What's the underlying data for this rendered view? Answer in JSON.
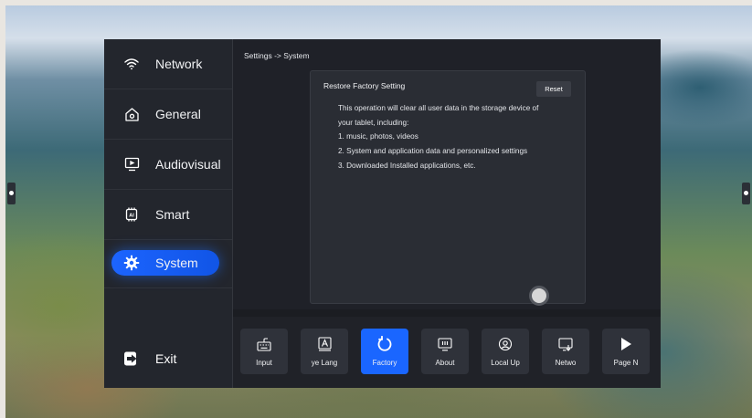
{
  "sidebar": {
    "items": [
      {
        "label": "Network",
        "icon": "wifi-icon"
      },
      {
        "label": "General",
        "icon": "home-settings-icon"
      },
      {
        "label": "Audiovisual",
        "icon": "monitor-icon"
      },
      {
        "label": "Smart",
        "icon": "ai-chip-icon"
      },
      {
        "label": "System",
        "icon": "gear-icon",
        "active": true
      }
    ],
    "exit_label": "Exit"
  },
  "main": {
    "breadcrumb": "Settings -> System",
    "card": {
      "title": "Restore Factory Setting",
      "reset_label": "Reset",
      "description": [
        "This operation will clear all user data in the storage device of",
        "your tablet, including:",
        "1. music, photos, videos",
        "2. System and application data and personalized settings",
        "3. Downloaded Installed applications, etc."
      ]
    }
  },
  "tiles": [
    {
      "label": "Input",
      "icon": "keyboard-icon"
    },
    {
      "label": "ye   Lang",
      "icon": "language-icon"
    },
    {
      "label": "Factory",
      "icon": "restore-icon",
      "active": true
    },
    {
      "label": "About",
      "icon": "info-monitor-icon"
    },
    {
      "label": "Local Up",
      "icon": "local-update-icon"
    },
    {
      "label": "Netwo",
      "icon": "network-update-icon"
    },
    {
      "label": "Page   N",
      "icon": "play-icon"
    }
  ],
  "colors": {
    "accent": "#1a66ff",
    "panel_bg": "#1f2128",
    "sidebar_bg": "#23262d",
    "card_bg": "#2a2d34"
  }
}
